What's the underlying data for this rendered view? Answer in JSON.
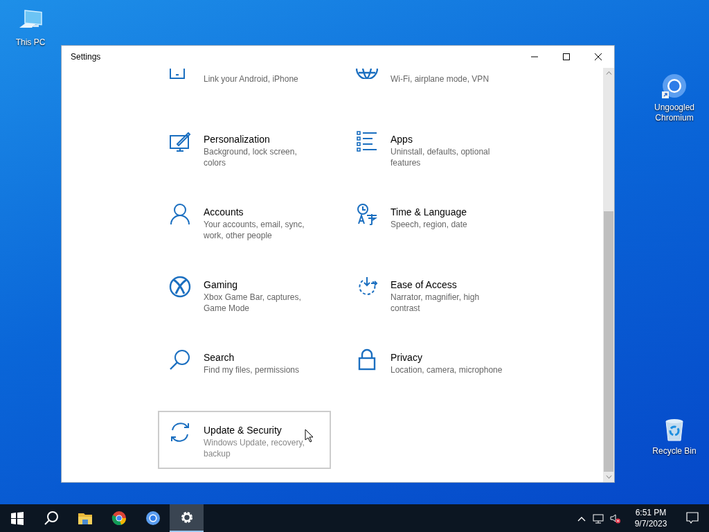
{
  "desktop_icons": [
    {
      "kind": "computer",
      "label": "This PC"
    },
    {
      "kind": "chromium",
      "label": "Ungoogled Chromium"
    },
    {
      "kind": "recycle",
      "label": "Recycle Bin"
    }
  ],
  "window": {
    "title": "Settings",
    "categories": [
      {
        "description": "Link your Android, iPhone",
        "selected": false
      },
      {
        "description": "Wi-Fi, airplane mode, VPN",
        "selected": false
      },
      {
        "title": "Personalization",
        "description": "Background, lock screen, colors",
        "selected": false
      },
      {
        "title": "Apps",
        "description": "Uninstall, defaults, optional features",
        "selected": false
      },
      {
        "title": "Accounts",
        "description": "Your accounts, email, sync, work, other people",
        "selected": false
      },
      {
        "title": "Time & Language",
        "description": "Speech, region, date",
        "selected": false
      },
      {
        "title": "Gaming",
        "description": "Xbox Game Bar, captures, Game Mode",
        "selected": false
      },
      {
        "title": "Ease of Access",
        "description": "Narrator, magnifier, high contrast",
        "selected": false
      },
      {
        "title": "Search",
        "description": "Find my files, permissions",
        "selected": false
      },
      {
        "title": "Privacy",
        "description": "Location, camera, microphone",
        "selected": false
      },
      {
        "title": "Update & Security",
        "description": "Windows Update, recovery, backup",
        "selected": true
      }
    ]
  },
  "taskbar": {
    "apps": [
      {
        "kind": "start",
        "active": false
      },
      {
        "kind": "search",
        "active": false
      },
      {
        "kind": "explorer",
        "active": false
      },
      {
        "kind": "chrome",
        "active": false
      },
      {
        "kind": "chromium",
        "active": false
      },
      {
        "kind": "settings",
        "active": true
      }
    ],
    "time": "6:51 PM",
    "date": "9/7/2023"
  }
}
